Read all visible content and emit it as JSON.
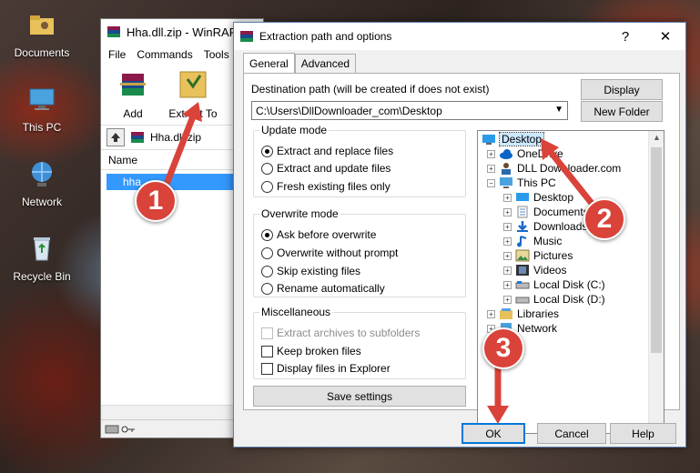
{
  "desktop": {
    "icons": [
      {
        "label": "Documents"
      },
      {
        "label": "This PC"
      },
      {
        "label": "Network"
      },
      {
        "label": "Recycle Bin"
      }
    ]
  },
  "winrar": {
    "title": "Hha.dll.zip - WinRAR",
    "menu": [
      "File",
      "Commands",
      "Tools"
    ],
    "toolbar": {
      "add": "Add",
      "extract_to": "Extract To"
    },
    "address": "Hha.dll.zip",
    "column_name": "Name",
    "selected_file": "hha"
  },
  "dialog": {
    "title": "Extraction path and options",
    "help_button": "?",
    "close_button": "✕",
    "tabs": {
      "general": "General",
      "advanced": "Advanced"
    },
    "destination_label": "Destination path (will be created if does not exist)",
    "destination_value": "C:\\Users\\DllDownloader_com\\Desktop",
    "display_button": "Display",
    "new_folder_button": "New Folder",
    "update_mode": {
      "title": "Update mode",
      "options": [
        "Extract and replace files",
        "Extract and update files",
        "Fresh existing files only"
      ],
      "selected": 0
    },
    "overwrite_mode": {
      "title": "Overwrite mode",
      "options": [
        "Ask before overwrite",
        "Overwrite without prompt",
        "Skip existing files",
        "Rename automatically"
      ],
      "selected": 0
    },
    "misc": {
      "title": "Miscellaneous",
      "extract_to_subfolders": "Extract archives to subfolders",
      "keep_broken": "Keep broken files",
      "display_in_explorer": "Display files in Explorer"
    },
    "save_settings_button": "Save settings",
    "tree": {
      "desktop": "Desktop",
      "onedrive": "OneDrive",
      "dlldownloader": "DLL Downloader.com",
      "this_pc": "This PC",
      "pc_desktop": "Desktop",
      "documents": "Documents",
      "downloads": "Downloads",
      "music": "Music",
      "pictures": "Pictures",
      "videos": "Videos",
      "local_c": "Local Disk (C:)",
      "local_d": "Local Disk (D:)",
      "libraries": "Libraries",
      "network": "Network"
    },
    "ok_button": "OK",
    "cancel_button": "Cancel",
    "help_bottom_button": "Help"
  },
  "steps": {
    "one": "1",
    "two": "2",
    "three": "3"
  },
  "colors": {
    "step_badge": "#d9433a",
    "selection": "#3399ff",
    "dialog_bg": "#f0f0f0"
  }
}
